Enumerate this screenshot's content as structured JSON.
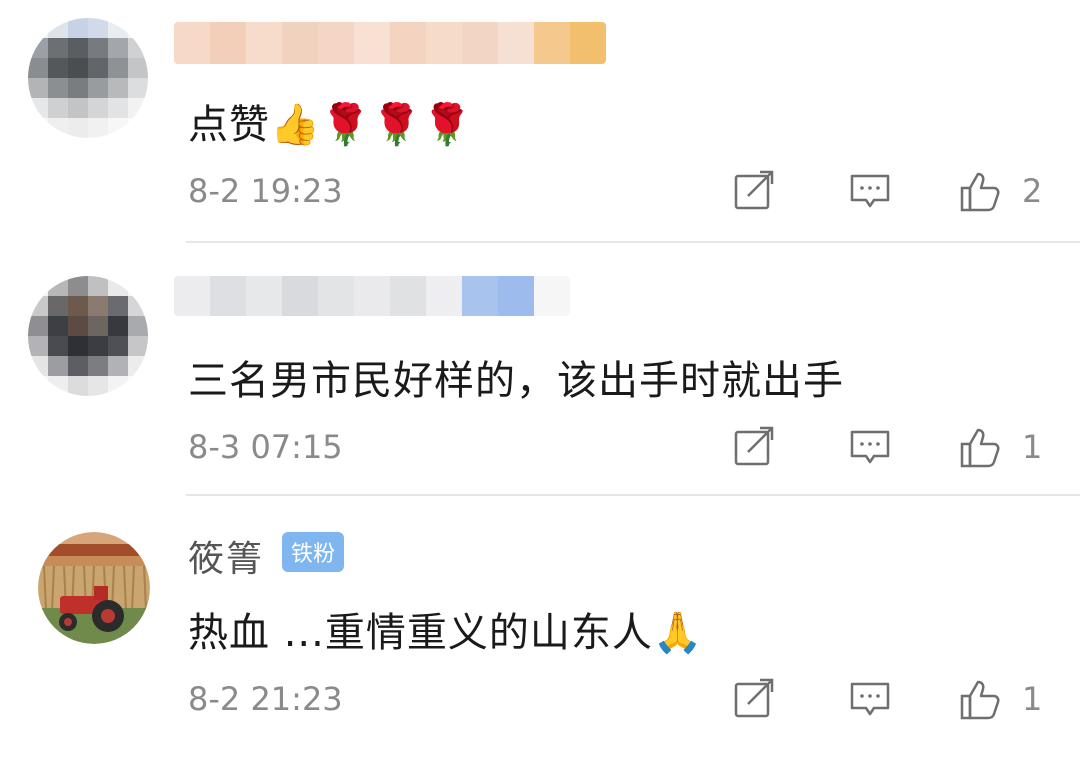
{
  "comments": [
    {
      "username": "",
      "badge": "",
      "text": "点赞👍🌹🌹🌹",
      "time": "8-2 19:23",
      "likes": "2",
      "icons": [
        "share-icon",
        "reply-icon",
        "like-icon"
      ]
    },
    {
      "username": "",
      "badge": "",
      "text": "三名男市民好样的，该出手时就出手",
      "time": "8-3 07:15",
      "likes": "1",
      "icons": [
        "share-icon",
        "reply-icon",
        "like-icon"
      ]
    },
    {
      "username": "筱箐",
      "badge": "铁粉",
      "text": "热血 ...重情重义的山东人🙏",
      "time": "8-2 21:23",
      "likes": "1",
      "icons": [
        "share-icon",
        "reply-icon",
        "like-icon"
      ]
    }
  ],
  "colors": {
    "text": "#1a1a1a",
    "meta": "#8a8a8a",
    "badge_bg": "#7fb6f0",
    "divider": "#e6e6e6"
  }
}
